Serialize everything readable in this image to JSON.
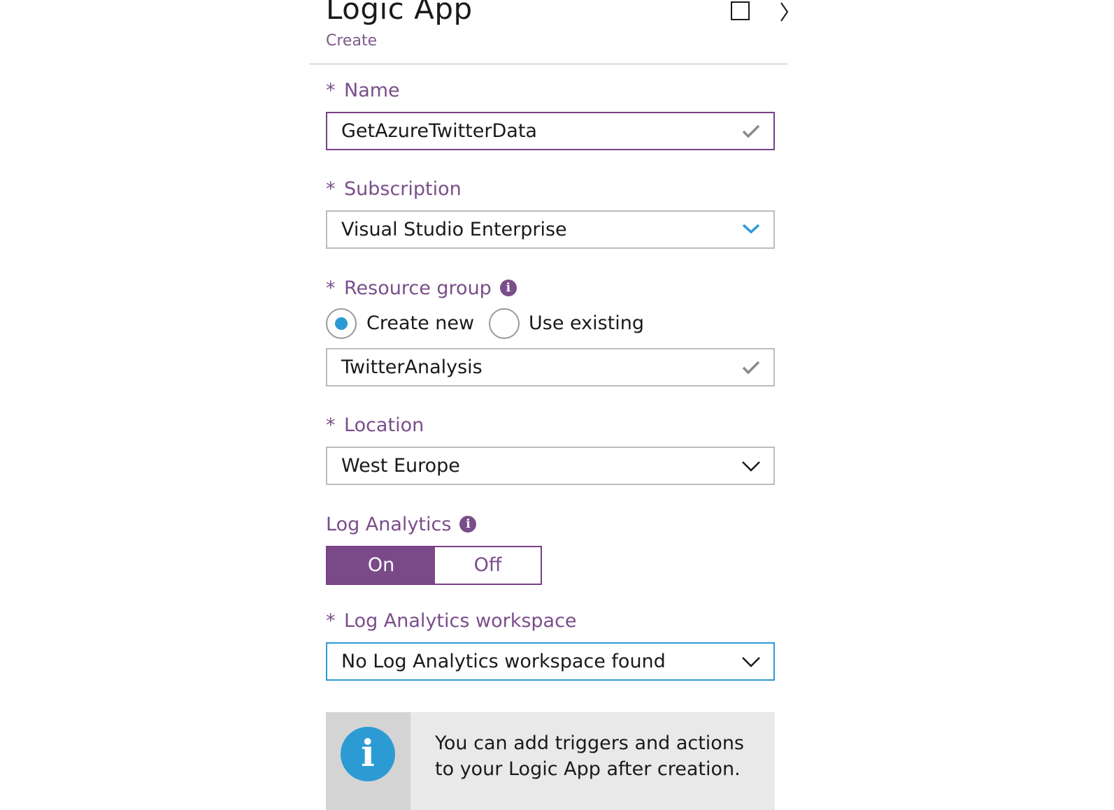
{
  "header": {
    "title": "Logic App",
    "subtitle": "Create"
  },
  "fields": {
    "name": {
      "required_mark": "*",
      "label": "Name",
      "value": "GetAzureTwitterData",
      "status_icon": "checkmark-icon"
    },
    "subscription": {
      "required_mark": "*",
      "label": "Subscription",
      "selected": "Visual Studio Enterprise",
      "dropdown_icon": "chevron-down-icon"
    },
    "resource_group": {
      "required_mark": "*",
      "label": "Resource group",
      "info_icon": "info-icon",
      "options": [
        "Create new",
        "Use existing"
      ],
      "selected_option": "Create new",
      "value": "TwitterAnalysis",
      "status_icon": "checkmark-icon"
    },
    "location": {
      "required_mark": "*",
      "label": "Location",
      "selected": "West Europe",
      "dropdown_icon": "chevron-down-icon"
    },
    "log_analytics": {
      "label": "Log Analytics",
      "info_icon": "info-icon",
      "on_label": "On",
      "off_label": "Off",
      "state": "On"
    },
    "workspace": {
      "required_mark": "*",
      "label": "Log Analytics workspace",
      "selected": "No Log Analytics workspace found",
      "dropdown_icon": "chevron-down-icon"
    }
  },
  "info_banner": {
    "icon_glyph": "i",
    "text": "You can add triggers and actions to your Logic App after creation."
  },
  "colors": {
    "accent_purple": "#7a4a88",
    "label_purple": "#7a4e8a",
    "accent_blue": "#2c9bd4",
    "border_gray": "#bcbcbc",
    "banner_bg": "#e9e9e9"
  }
}
